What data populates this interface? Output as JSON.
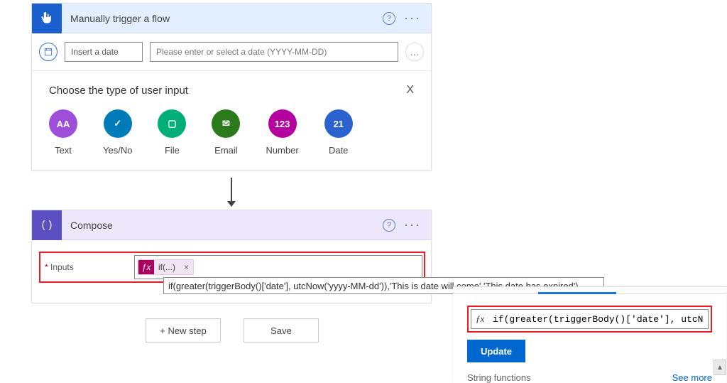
{
  "trigger": {
    "title": "Manually trigger a flow",
    "param_name": "Insert a date",
    "param_placeholder": "Please enter or select a date (YYYY-MM-DD)",
    "input_type_heading": "Choose the type of user input",
    "close_x": "X",
    "types": {
      "text": "Text",
      "yesno": "Yes/No",
      "file": "File",
      "email": "Email",
      "number": "Number",
      "date": "Date"
    },
    "type_icon_glyphs": {
      "text": "AA",
      "yesno": "✓",
      "file": "▢",
      "email": "✉",
      "number": "123",
      "date": "21"
    }
  },
  "compose": {
    "title": "Compose",
    "inputs_label": "Inputs",
    "fx_chip_label": "if(...)",
    "fx_chip_close": "×"
  },
  "tooltip_text": "if(greater(triggerBody()['date'], utcNow('yyyy-MM-dd')),'This is date will come','This date has expired')",
  "buttons": {
    "new_step": "+ New step",
    "save": "Save"
  },
  "expression_panel": {
    "input_value": "if(greater(triggerBody()['date'], utcNow('",
    "update_label": "Update",
    "section_label": "String functions",
    "see_more": "See more"
  }
}
